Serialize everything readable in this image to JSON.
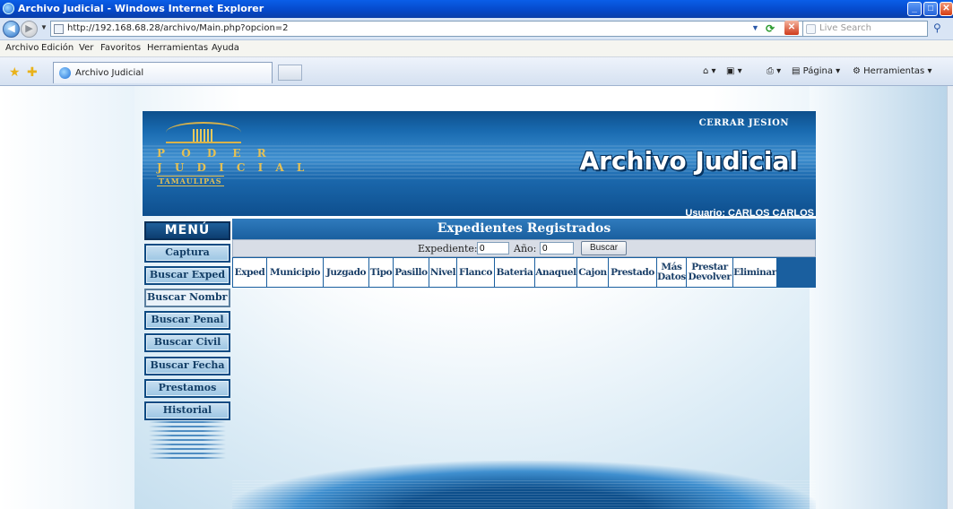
{
  "window": {
    "title": "Archivo Judicial - Windows Internet Explorer"
  },
  "address_bar": {
    "url": "http://192.168.68.28/archivo/Main.php?opcion=2"
  },
  "search_box": {
    "placeholder": "Live Search"
  },
  "menu_bar": {
    "items": [
      "Archivo",
      "Edición",
      "Ver",
      "Favoritos",
      "Herramientas",
      "Ayuda"
    ]
  },
  "tabs": [
    {
      "label": "Archivo Judicial"
    }
  ],
  "command_bar": {
    "page_label": "Página",
    "tools_label": "Herramientas"
  },
  "header": {
    "logout_label": "CERRAR JESION",
    "app_title": "Archivo Judicial",
    "user_label": "Usuario: CARLOS CARLOS",
    "logo": {
      "line1": "P O D E R",
      "line2": "J U D I C I A L",
      "line3": "TAMAULIPAS"
    }
  },
  "menu": {
    "title": "MENÚ",
    "items": [
      {
        "label": "Captura"
      },
      {
        "label": "Buscar Exped"
      },
      {
        "label": "Buscar Nombre"
      },
      {
        "label": "Buscar Penal"
      },
      {
        "label": "Buscar Civil"
      },
      {
        "label": "Buscar Fecha"
      },
      {
        "label": "Prestamos"
      },
      {
        "label": "Historial"
      }
    ],
    "selected_index": 2
  },
  "main": {
    "section_title": "Expedientes Registrados",
    "search": {
      "expediente_label": "Expediente:",
      "expediente_value": "0",
      "anio_label": "Año:",
      "anio_value": "0",
      "button_label": "Buscar"
    },
    "table": {
      "columns": [
        "Exped",
        "Municipio",
        "Juzgado",
        "Tipo",
        "Pasillo",
        "Nivel",
        "Flanco",
        "Bateria",
        "Anaquel",
        "Cajon",
        "Prestado",
        "Más\nDatos",
        "Prestar\nDevolver",
        "Eliminar"
      ],
      "rows": []
    }
  },
  "colors": {
    "banner_blue": "#1a6cb2",
    "menu_dark": "#0f4b83",
    "menu_button": "#b3d4ec",
    "table_border": "#1a5f9f"
  }
}
